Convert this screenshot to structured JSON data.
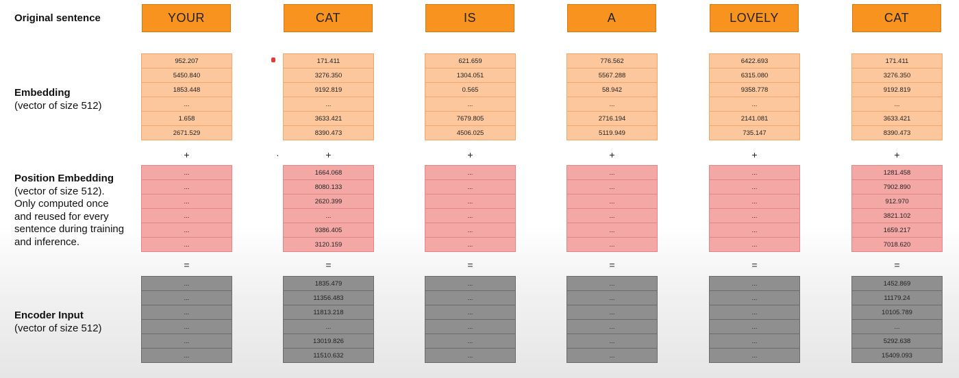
{
  "labels": {
    "original": {
      "bold": "Original sentence"
    },
    "embedding": {
      "bold": "Embedding",
      "sub": "(vector of size 512)"
    },
    "position": {
      "bold": "Position Embedding",
      "sub": "(vector of size 512). Only computed once and reused for every sentence during training and inference."
    },
    "encoder": {
      "bold": "Encoder Input",
      "sub": "(vector of size 512)"
    }
  },
  "operators": {
    "plus": "+",
    "equals": "="
  },
  "columns": [
    {
      "word": "YOUR",
      "embedding": [
        "952.207",
        "5450.840",
        "1853.448",
        "...",
        "1.658",
        "2671.529"
      ],
      "position": [
        "...",
        "...",
        "...",
        "...",
        "...",
        "..."
      ],
      "encoder": [
        "...",
        "...",
        "...",
        "...",
        "...",
        "..."
      ]
    },
    {
      "word": "CAT",
      "embedding": [
        "171.411",
        "3276.350",
        "9192.819",
        "...",
        "3633.421",
        "8390.473"
      ],
      "position": [
        "1664.068",
        "8080.133",
        "2620.399",
        "...",
        "9386.405",
        "3120.159"
      ],
      "encoder": [
        "1835.479",
        "11356.483",
        "11813.218",
        "...",
        "13019.826",
        "11510.632"
      ]
    },
    {
      "word": "IS",
      "embedding": [
        "621.659",
        "1304.051",
        "0.565",
        "...",
        "7679.805",
        "4506.025"
      ],
      "position": [
        "...",
        "...",
        "...",
        "...",
        "...",
        "..."
      ],
      "encoder": [
        "...",
        "...",
        "...",
        "...",
        "...",
        "..."
      ]
    },
    {
      "word": "A",
      "embedding": [
        "776.562",
        "5567.288",
        "58.942",
        "...",
        "2716.194",
        "5119.949"
      ],
      "position": [
        "...",
        "...",
        "...",
        "...",
        "...",
        "..."
      ],
      "encoder": [
        "...",
        "...",
        "...",
        "...",
        "...",
        "..."
      ]
    },
    {
      "word": "LOVELY",
      "embedding": [
        "6422.693",
        "6315.080",
        "9358.778",
        "...",
        "2141.081",
        "735.147"
      ],
      "position": [
        "...",
        "...",
        "...",
        "...",
        "...",
        "..."
      ],
      "encoder": [
        "...",
        "...",
        "...",
        "...",
        "...",
        "..."
      ]
    },
    {
      "word": "CAT",
      "embedding": [
        "171.411",
        "3276.350",
        "9192.819",
        "...",
        "3633.421",
        "8390.473"
      ],
      "position": [
        "1281.458",
        "7902.890",
        "912.970",
        "3821.102",
        "1659.217",
        "7018.620"
      ],
      "encoder": [
        "1452.869",
        "11179.24",
        "10105.789",
        "...",
        "5292.638",
        "15409.093"
      ]
    }
  ],
  "colors": {
    "word_box": "#f7931e",
    "embedding": "#fcc79c",
    "position": "#f4a8a6",
    "encoder": "#8f8f8f"
  }
}
